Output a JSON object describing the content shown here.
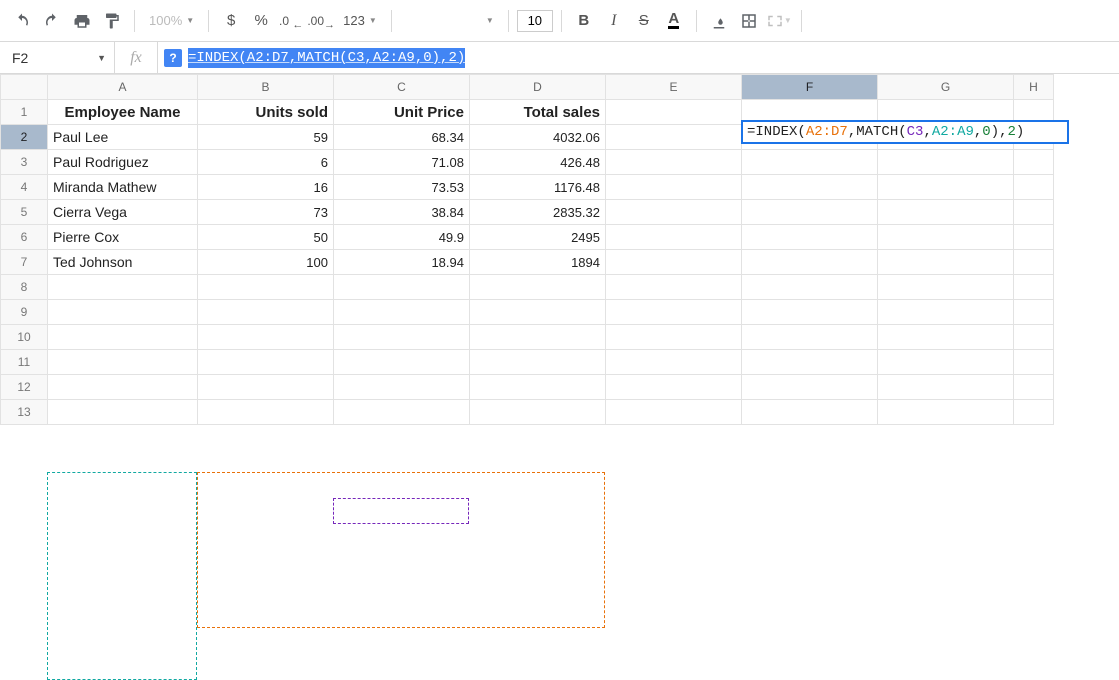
{
  "toolbar": {
    "zoom": "100%",
    "currency": "$",
    "percent": "%",
    "dec_dec": ".0",
    "inc_dec": ".00",
    "numfmt": "123",
    "font_size": "10",
    "bold": "B",
    "italic": "I",
    "strike": "S",
    "textcolor": "A"
  },
  "namebox": "F2",
  "fx_label": "fx",
  "help": "?",
  "formula_text": "=INDEX(A2:D7,MATCH(C3,A2:A9,0),2)",
  "columns": [
    "A",
    "B",
    "C",
    "D",
    "E",
    "F",
    "G",
    "H"
  ],
  "rows": [
    "1",
    "2",
    "3",
    "4",
    "5",
    "6",
    "7",
    "8",
    "9",
    "10",
    "11",
    "12",
    "13"
  ],
  "headers": {
    "A": "Employee Name",
    "B": "Units sold",
    "C": "Unit Price",
    "D": "Total sales"
  },
  "data": [
    {
      "name": "Paul Lee",
      "units": "59",
      "price": "68.34",
      "total": "4032.06"
    },
    {
      "name": "Paul Rodriguez",
      "units": "6",
      "price": "71.08",
      "total": "426.48"
    },
    {
      "name": "Miranda Mathew",
      "units": "16",
      "price": "73.53",
      "total": "1176.48"
    },
    {
      "name": "Cierra Vega",
      "units": "73",
      "price": "38.84",
      "total": "2835.32"
    },
    {
      "name": "Pierre Cox",
      "units": "50",
      "price": "49.9",
      "total": "2495"
    },
    {
      "name": "Ted Johnson",
      "units": "100",
      "price": "18.94",
      "total": "1894"
    }
  ],
  "active_formula_parts": {
    "pre": "=INDEX(",
    "r1": "A2:D7",
    "c1": ",MATCH(",
    "r2": "C3",
    "c2": ",",
    "r3": "A2:A9",
    "c3": ",",
    "z1": "0",
    "c4": "),",
    "z2": "2",
    "c5": ")"
  }
}
